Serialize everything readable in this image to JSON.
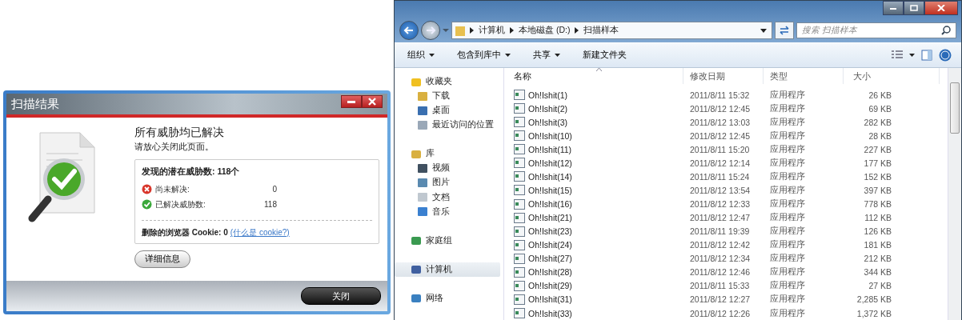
{
  "dialog": {
    "title": "扫描结果",
    "headline": "所有威胁均已解决",
    "subline": "请放心关闭此页面。",
    "summary": {
      "title": "发现的潜在威胁数: 118个",
      "items": [
        {
          "kind": "error",
          "label": "尚未解决:",
          "value": "0"
        },
        {
          "kind": "ok",
          "label": "已解决威胁数:",
          "value": "118"
        }
      ],
      "cookie_label": "删除的浏览器 Cookie: 0",
      "cookie_link": "(什么是 cookie?)"
    },
    "details_button": "详细信息",
    "close_button": "关闭"
  },
  "explorer": {
    "breadcrumb": [
      "计算机",
      "本地磁盘 (D:)",
      "扫描样本"
    ],
    "search": {
      "placeholder": "搜索 扫描样本"
    },
    "toolbar": [
      {
        "label": "组织",
        "dropdown": true
      },
      {
        "label": "包含到库中",
        "dropdown": true
      },
      {
        "label": "共享",
        "dropdown": true
      },
      {
        "label": "新建文件夹",
        "dropdown": false
      }
    ],
    "sidebar": [
      {
        "label": "收藏夹",
        "selected": false,
        "children": [
          {
            "label": "下载",
            "selected": false
          },
          {
            "label": "桌面",
            "selected": false
          },
          {
            "label": "最近访问的位置",
            "selected": false
          }
        ]
      },
      {
        "label": "库",
        "selected": false,
        "children": [
          {
            "label": "视频",
            "selected": false
          },
          {
            "label": "图片",
            "selected": false
          },
          {
            "label": "文档",
            "selected": false
          },
          {
            "label": "音乐",
            "selected": false
          }
        ]
      },
      {
        "label": "家庭组",
        "selected": false
      },
      {
        "label": "计算机",
        "selected": true
      },
      {
        "label": "网络",
        "selected": false
      }
    ],
    "columns": [
      "名称",
      "修改日期",
      "类型",
      "大小"
    ],
    "rows": [
      {
        "name": "Oh!Ishit(1)",
        "date": "2011/8/11 15:32",
        "type": "应用程序",
        "size": "26 KB"
      },
      {
        "name": "Oh!Ishit(2)",
        "date": "2011/8/12 12:45",
        "type": "应用程序",
        "size": "69 KB"
      },
      {
        "name": "Oh!Ishit(3)",
        "date": "2011/8/12 13:03",
        "type": "应用程序",
        "size": "282 KB"
      },
      {
        "name": "Oh!Ishit(10)",
        "date": "2011/8/12 12:45",
        "type": "应用程序",
        "size": "28 KB"
      },
      {
        "name": "Oh!Ishit(11)",
        "date": "2011/8/11 15:20",
        "type": "应用程序",
        "size": "227 KB"
      },
      {
        "name": "Oh!Ishit(12)",
        "date": "2011/8/12 12:14",
        "type": "应用程序",
        "size": "177 KB"
      },
      {
        "name": "Oh!Ishit(14)",
        "date": "2011/8/11 15:24",
        "type": "应用程序",
        "size": "152 KB"
      },
      {
        "name": "Oh!Ishit(15)",
        "date": "2011/8/12 13:54",
        "type": "应用程序",
        "size": "397 KB"
      },
      {
        "name": "Oh!Ishit(16)",
        "date": "2011/8/12 12:33",
        "type": "应用程序",
        "size": "778 KB"
      },
      {
        "name": "Oh!Ishit(21)",
        "date": "2011/8/12 12:47",
        "type": "应用程序",
        "size": "112 KB"
      },
      {
        "name": "Oh!Ishit(23)",
        "date": "2011/8/11 19:39",
        "type": "应用程序",
        "size": "126 KB"
      },
      {
        "name": "Oh!Ishit(24)",
        "date": "2011/8/12 12:42",
        "type": "应用程序",
        "size": "181 KB"
      },
      {
        "name": "Oh!Ishit(27)",
        "date": "2011/8/12 12:34",
        "type": "应用程序",
        "size": "212 KB"
      },
      {
        "name": "Oh!Ishit(28)",
        "date": "2011/8/12 12:46",
        "type": "应用程序",
        "size": "344 KB"
      },
      {
        "name": "Oh!Ishit(29)",
        "date": "2011/8/11 15:33",
        "type": "应用程序",
        "size": "27 KB"
      },
      {
        "name": "Oh!Ishit(31)",
        "date": "2011/8/12 12:27",
        "type": "应用程序",
        "size": "2,285 KB"
      },
      {
        "name": "Oh!Ishit(33)",
        "date": "2011/8/12 12:26",
        "type": "应用程序",
        "size": "1,372 KB"
      }
    ]
  }
}
